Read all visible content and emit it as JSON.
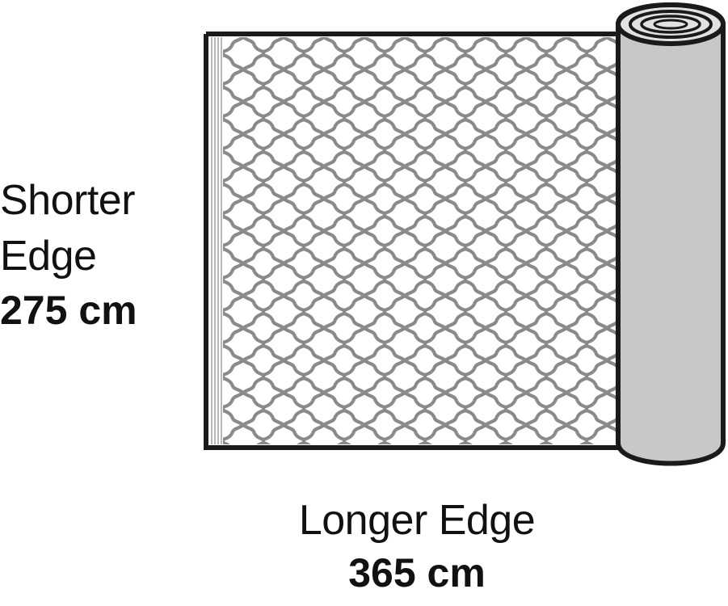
{
  "shorter_edge": {
    "label_line1": "Shorter",
    "label_line2": "Edge",
    "measurement": "275 cm"
  },
  "longer_edge": {
    "label": "Longer Edge",
    "measurement": "365 cm"
  },
  "colors": {
    "outline": "#1a1a1a",
    "pattern": "#8a8a8a",
    "roll_fill": "#c8c8c8",
    "rug_background": "#ffffff"
  }
}
